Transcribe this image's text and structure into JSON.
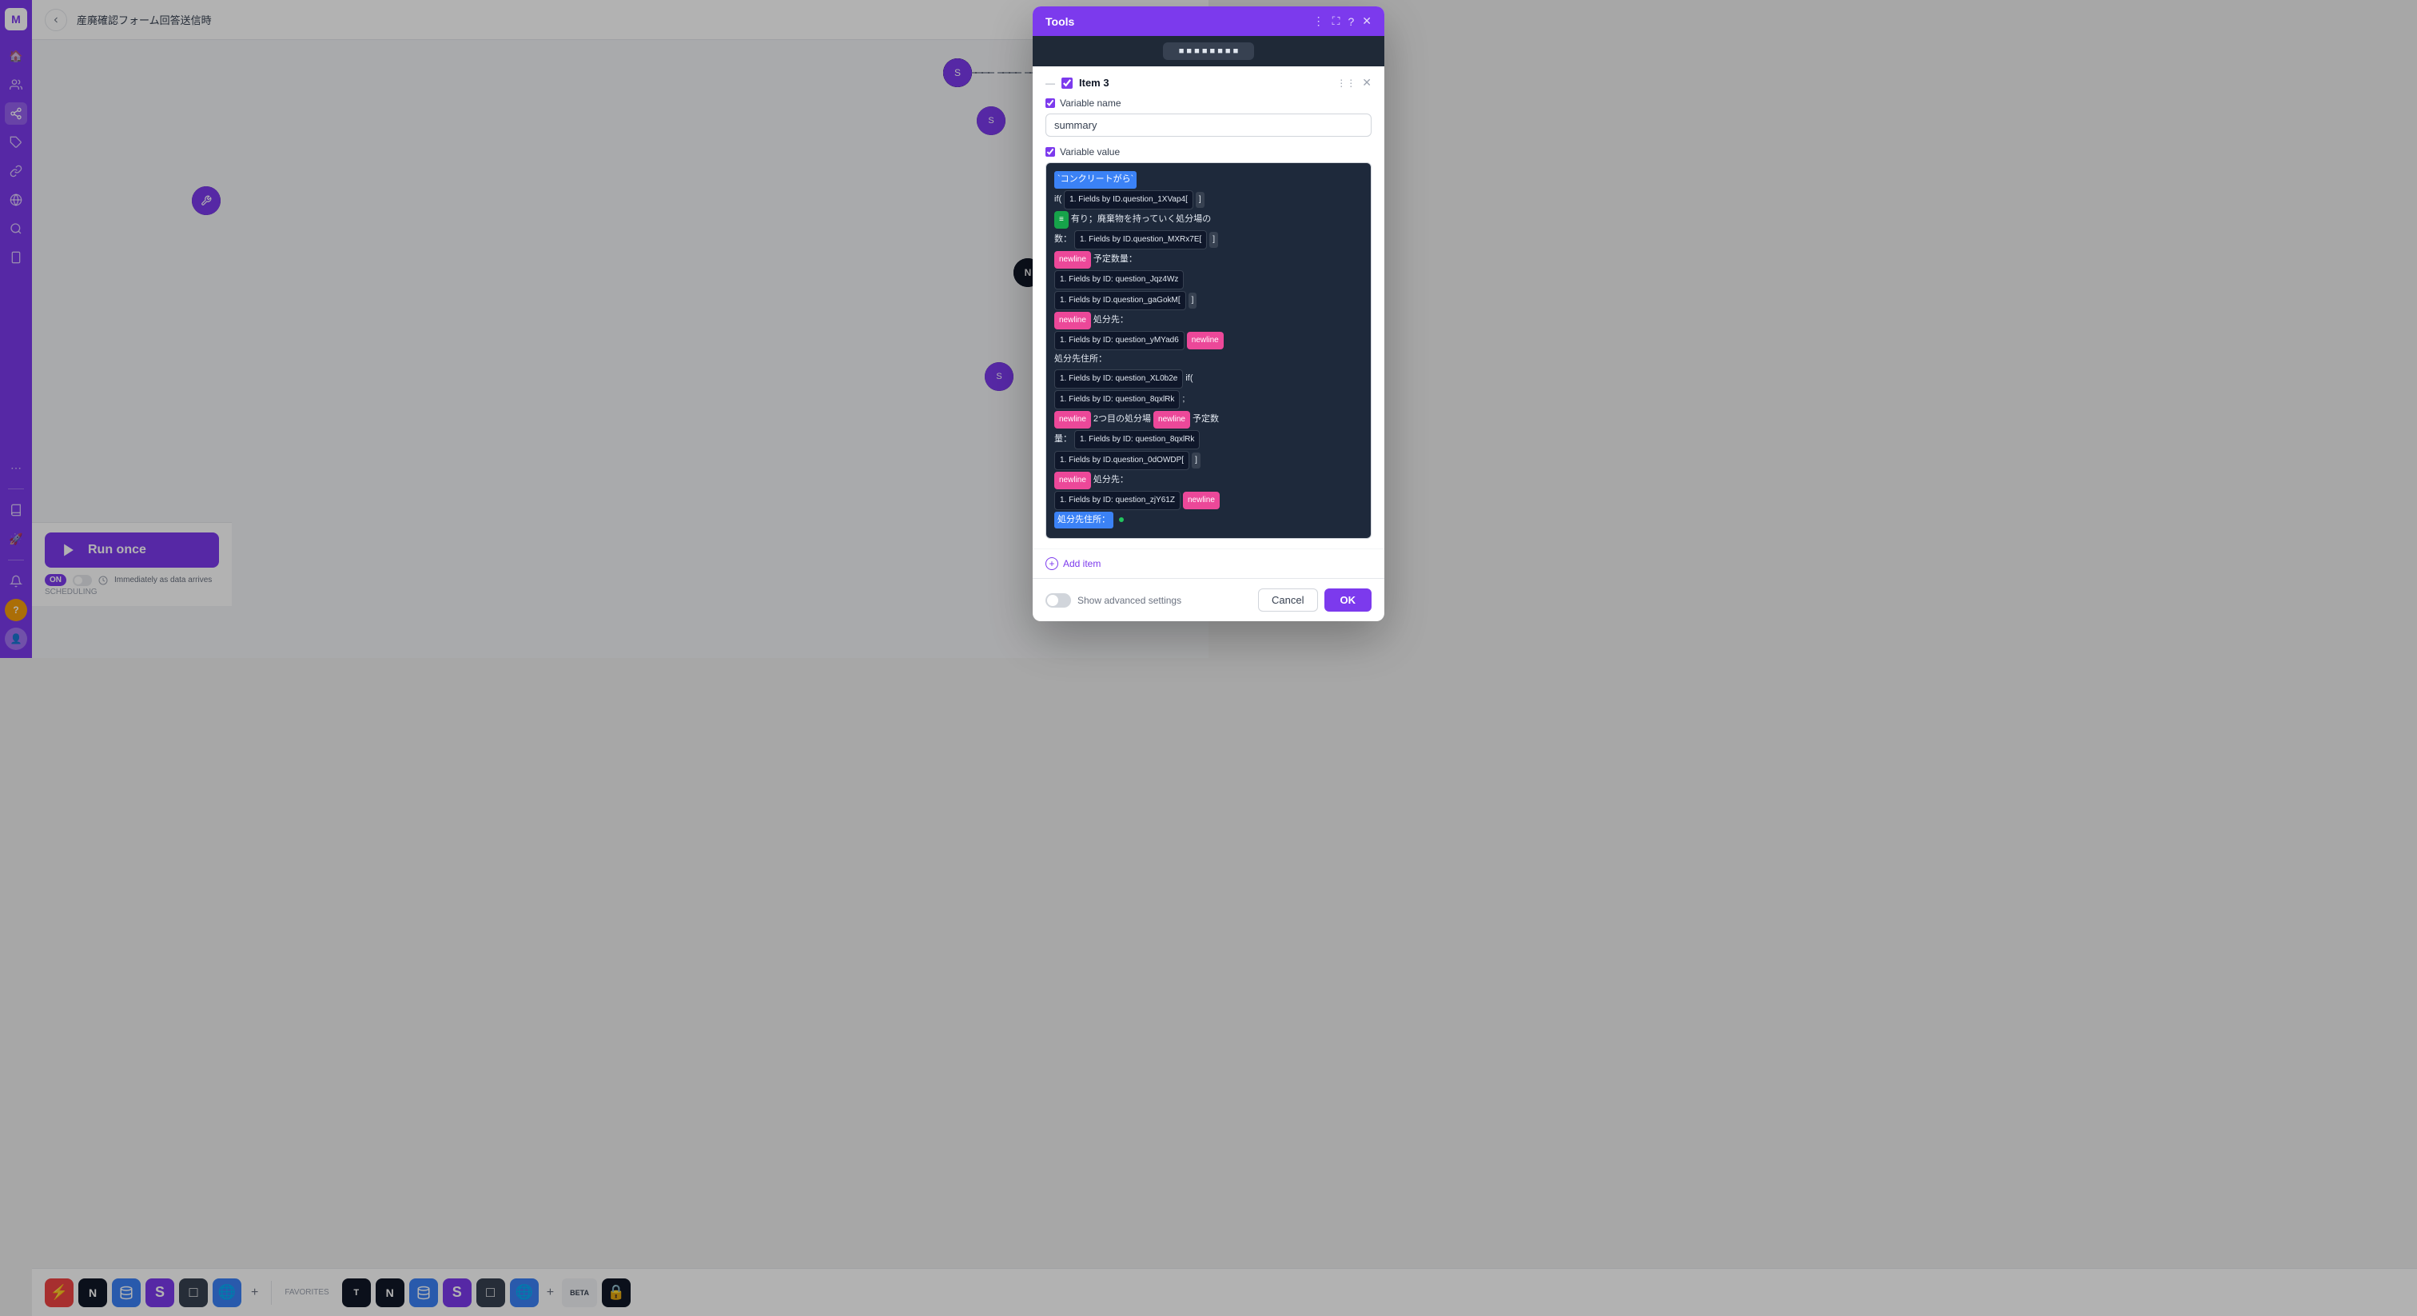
{
  "sidebar": {
    "logo": "M",
    "items": [
      {
        "id": "home",
        "icon": "🏠",
        "active": false
      },
      {
        "id": "users",
        "icon": "👥",
        "active": false
      },
      {
        "id": "share",
        "icon": "↗",
        "active": true
      },
      {
        "id": "puzzle",
        "icon": "🧩",
        "active": false
      },
      {
        "id": "link",
        "icon": "🔗",
        "active": false
      },
      {
        "id": "globe",
        "icon": "🌐",
        "active": false
      },
      {
        "id": "search",
        "icon": "🔍",
        "active": false
      },
      {
        "id": "phone",
        "icon": "📱",
        "active": false
      },
      {
        "id": "more",
        "icon": "⋯",
        "active": false
      }
    ]
  },
  "topbar": {
    "back_label": "←",
    "title": "産廃確認フォーム回答送信時"
  },
  "dialog": {
    "title": "Tools",
    "item_title": "Item 3",
    "variable_name_label": "Variable name",
    "variable_name_value": "summary",
    "variable_value_label": "Variable value",
    "add_item_label": "Add item",
    "show_advanced_label": "Show advanced settings",
    "cancel_label": "Cancel",
    "ok_label": "OK",
    "code_content": "`コンクリートがら` if( 1. Fields by ID.question_1XVap4[ ] = 有り ; 廃棄物を持っていく処分場の数 : 1. Fields by ID.question_MXRx7E[ ] newline 予定数量： 1. Fields by ID: question_Jqz4Wz 1. Fields by ID.question_gaGokM[ ] newline 処分先： 1. Fields by ID: question_yMYad6 newline 処分先住所： 1. Fields by ID: question_XL0b2e if( 1. Fields by ID: question_8qxlRk ; newline 2つ目の処分場 newline 予定数量： 1. Fields by ID: question_8qxlRk 1. Fields by ID.question_0dOWDP[ ] newline 処分先： 1. Fields by ID: question_zjY61Z newline 処分先住所："
  },
  "run_once": {
    "button_label": "Run once",
    "scheduling_label": "SCHEDULING",
    "toggle_label": "ON",
    "schedule_text": "Immediately as data arrives"
  },
  "favorites": {
    "section_label": "FAVORITES",
    "items": [
      {
        "id": "zapier",
        "color": "#ef4444",
        "icon": "⚡"
      },
      {
        "id": "notion1",
        "color": "#111827",
        "icon": "N"
      },
      {
        "id": "database",
        "color": "#3b82f6",
        "icon": "🗄"
      },
      {
        "id": "slack1",
        "color": "#7c3aed",
        "icon": "S"
      },
      {
        "id": "frame",
        "color": "#374151",
        "icon": "□"
      },
      {
        "id": "globe2",
        "color": "#3b82f6",
        "icon": "🌐"
      },
      {
        "id": "add",
        "color": "#e5e7eb",
        "icon": "+"
      },
      {
        "id": "beta",
        "color": "#f3f4f6",
        "icon": "BETA"
      },
      {
        "id": "lock",
        "color": "#111827",
        "icon": "🔒"
      }
    ]
  }
}
